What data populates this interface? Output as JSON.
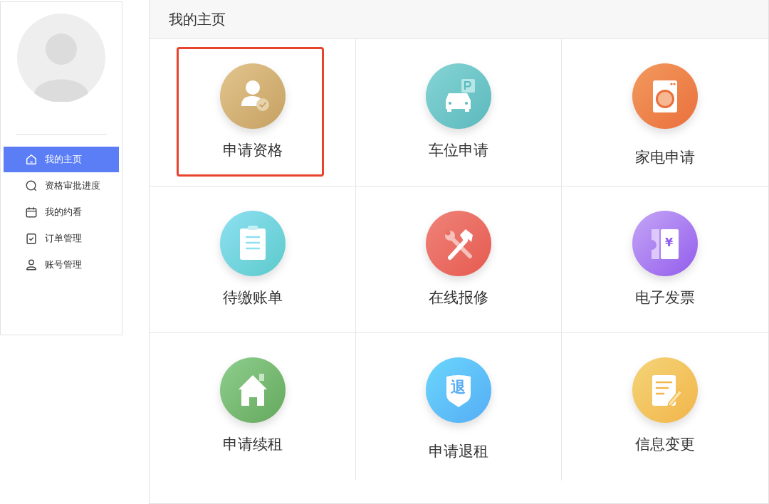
{
  "sidebar": {
    "items": [
      {
        "label": "我的主页",
        "selected": true
      },
      {
        "label": "资格审批进度",
        "selected": false
      },
      {
        "label": "我的约看",
        "selected": false
      },
      {
        "label": "订单管理",
        "selected": false
      },
      {
        "label": "账号管理",
        "selected": false
      }
    ]
  },
  "main": {
    "title": "我的主页",
    "tiles": [
      {
        "label": "申请资格",
        "highlighted": true
      },
      {
        "label": "车位申请",
        "highlighted": false
      },
      {
        "label": "家电申请",
        "highlighted": false
      },
      {
        "label": "待缴账单",
        "highlighted": false
      },
      {
        "label": "在线报修",
        "highlighted": false
      },
      {
        "label": "电子发票",
        "highlighted": false,
        "icon_text": "¥"
      },
      {
        "label": "申请续租",
        "highlighted": false
      },
      {
        "label": "申请退租",
        "highlighted": false,
        "icon_text": "退"
      },
      {
        "label": "信息变更",
        "highlighted": false
      }
    ]
  }
}
